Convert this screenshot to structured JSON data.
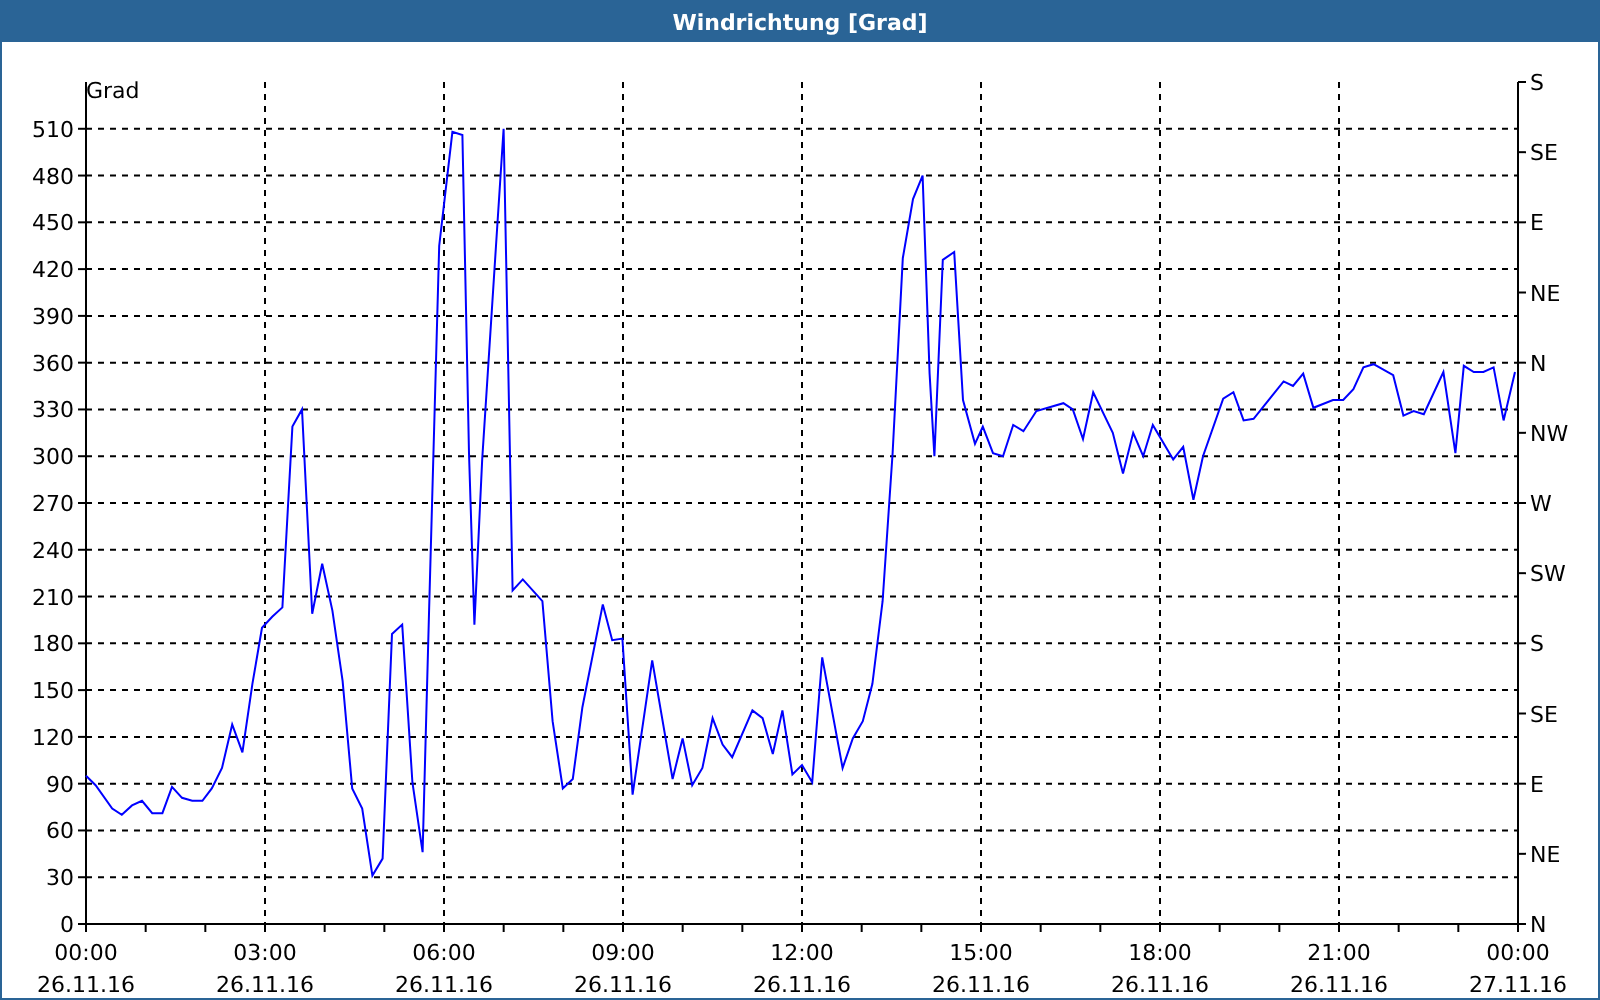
{
  "window": {
    "title": "Windrichtung [Grad]"
  },
  "chart": {
    "compass_labels": [
      "S",
      "SE",
      "E",
      "NE",
      "N",
      "NW",
      "W",
      "SW",
      "S",
      "SE",
      "E",
      "NE",
      "N"
    ],
    "xtick_dates": [
      "26.11.16",
      "26.11.16",
      "26.11.16",
      "26.11.16",
      "26.11.16",
      "26.11.16",
      "26.11.16",
      "26.11.16",
      "27.11.16"
    ],
    "chart_data": {
      "type": "line",
      "grid": true,
      "ylabel": "Grad",
      "xlim": [
        0,
        24
      ],
      "ylim": [
        0,
        540
      ],
      "xticks": [
        {
          "value": 0,
          "label": "00:00"
        },
        {
          "value": 3,
          "label": "03:00"
        },
        {
          "value": 6,
          "label": "06:00"
        },
        {
          "value": 9,
          "label": "09:00"
        },
        {
          "value": 12,
          "label": "12:00"
        },
        {
          "value": 15,
          "label": "15:00"
        },
        {
          "value": 18,
          "label": "18:00"
        },
        {
          "value": 21,
          "label": "21:00"
        },
        {
          "value": 24,
          "label": "00:00"
        }
      ],
      "yticks": [
        0,
        30,
        60,
        90,
        120,
        150,
        180,
        210,
        240,
        270,
        300,
        330,
        360,
        390,
        420,
        450,
        480,
        510
      ],
      "x": [
        0,
        0.16,
        0.44,
        0.6,
        0.77,
        0.94,
        1.11,
        1.28,
        1.44,
        1.61,
        1.78,
        1.95,
        2.11,
        2.28,
        2.45,
        2.62,
        2.79,
        2.95,
        3.12,
        3.29,
        3.46,
        3.62,
        3.79,
        3.96,
        4.13,
        4.3,
        4.46,
        4.63,
        4.8,
        4.97,
        5.13,
        5.3,
        5.47,
        5.64,
        5.75,
        5.92,
        6.14,
        6.31,
        6.42,
        6.51,
        6.64,
        6.87,
        7.0,
        7.15,
        7.32,
        7.65,
        7.82,
        7.99,
        8.16,
        8.32,
        8.66,
        8.82,
        8.99,
        9.16,
        9.49,
        9.83,
        10.0,
        10.16,
        10.33,
        10.5,
        10.67,
        10.83,
        11.17,
        11.34,
        11.51,
        11.67,
        11.84,
        12.0,
        12.17,
        12.34,
        12.68,
        12.85,
        13.02,
        13.18,
        13.35,
        13.52,
        13.69,
        13.86,
        14.02,
        14.14,
        14.22,
        14.36,
        14.55,
        14.7,
        14.9,
        15.03,
        15.2,
        15.37,
        15.54,
        15.71,
        15.93,
        16.38,
        16.54,
        16.71,
        16.88,
        17.21,
        17.38,
        17.55,
        17.72,
        17.88,
        18.22,
        18.39,
        18.56,
        18.72,
        19.06,
        19.23,
        19.4,
        19.57,
        20.07,
        20.23,
        20.4,
        20.57,
        20.9,
        21.07,
        21.24,
        21.41,
        21.58,
        21.91,
        22.08,
        22.25,
        22.42,
        22.75,
        22.95,
        23.09,
        23.26,
        23.42,
        23.59,
        23.76,
        23.95
      ],
      "series": [
        {
          "color": "#0000ff",
          "values": [
            95,
            89,
            74,
            70,
            76,
            79,
            71,
            71,
            88,
            81,
            79,
            79,
            87,
            100,
            128,
            110,
            154,
            190,
            197,
            203,
            319,
            330,
            199,
            231,
            201,
            156,
            87,
            74,
            31,
            42,
            186,
            192,
            91,
            46,
            199,
            435,
            508,
            506,
            302,
            192,
            298,
            435,
            510,
            214,
            221,
            207,
            130,
            87,
            93,
            139,
            205,
            182,
            183,
            83,
            169,
            93,
            119,
            89,
            100,
            132,
            115,
            107,
            137,
            132,
            109,
            137,
            96,
            102,
            91,
            171,
            100,
            119,
            130,
            154,
            207,
            302,
            427,
            465,
            480,
            353,
            300,
            426,
            431,
            336,
            308,
            319,
            302,
            300,
            320,
            316,
            329,
            334,
            330,
            311,
            341,
            315,
            289,
            315,
            300,
            320,
            298,
            306,
            272,
            300,
            337,
            341,
            323,
            324,
            348,
            345,
            353,
            331,
            336,
            336,
            343,
            357,
            359,
            352,
            326,
            329,
            327,
            354,
            302,
            358,
            354,
            354,
            357,
            323,
            354
          ]
        }
      ]
    }
  }
}
